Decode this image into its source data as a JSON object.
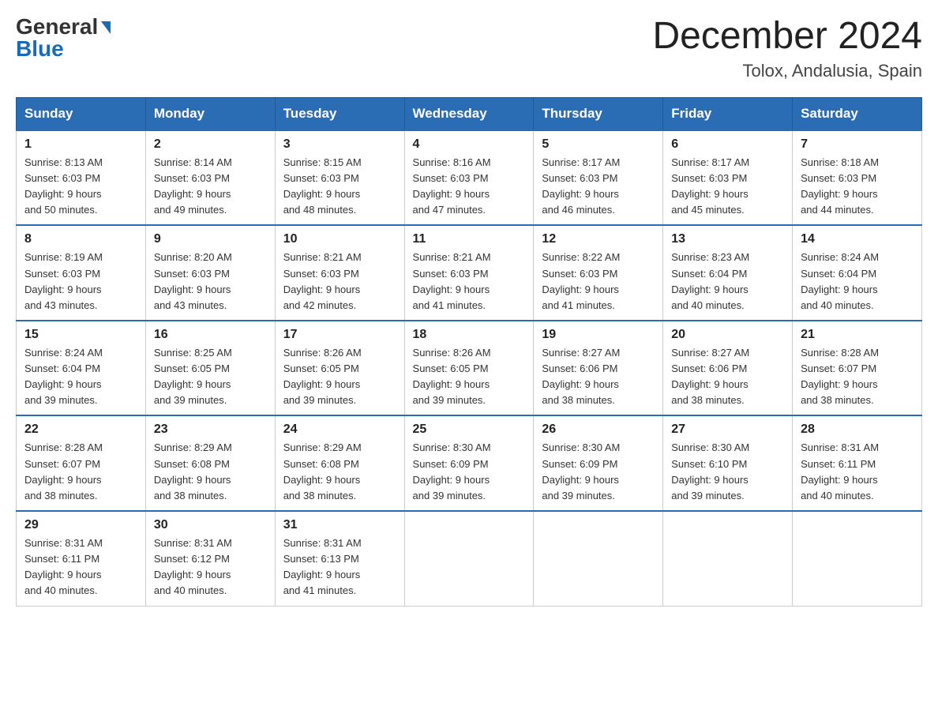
{
  "header": {
    "logo_general": "General",
    "logo_blue": "Blue",
    "month_title": "December 2024",
    "location": "Tolox, Andalusia, Spain"
  },
  "weekdays": [
    "Sunday",
    "Monday",
    "Tuesday",
    "Wednesday",
    "Thursday",
    "Friday",
    "Saturday"
  ],
  "weeks": [
    [
      {
        "day": "1",
        "sunrise": "8:13 AM",
        "sunset": "6:03 PM",
        "daylight": "9 hours and 50 minutes."
      },
      {
        "day": "2",
        "sunrise": "8:14 AM",
        "sunset": "6:03 PM",
        "daylight": "9 hours and 49 minutes."
      },
      {
        "day": "3",
        "sunrise": "8:15 AM",
        "sunset": "6:03 PM",
        "daylight": "9 hours and 48 minutes."
      },
      {
        "day": "4",
        "sunrise": "8:16 AM",
        "sunset": "6:03 PM",
        "daylight": "9 hours and 47 minutes."
      },
      {
        "day": "5",
        "sunrise": "8:17 AM",
        "sunset": "6:03 PM",
        "daylight": "9 hours and 46 minutes."
      },
      {
        "day": "6",
        "sunrise": "8:17 AM",
        "sunset": "6:03 PM",
        "daylight": "9 hours and 45 minutes."
      },
      {
        "day": "7",
        "sunrise": "8:18 AM",
        "sunset": "6:03 PM",
        "daylight": "9 hours and 44 minutes."
      }
    ],
    [
      {
        "day": "8",
        "sunrise": "8:19 AM",
        "sunset": "6:03 PM",
        "daylight": "9 hours and 43 minutes."
      },
      {
        "day": "9",
        "sunrise": "8:20 AM",
        "sunset": "6:03 PM",
        "daylight": "9 hours and 43 minutes."
      },
      {
        "day": "10",
        "sunrise": "8:21 AM",
        "sunset": "6:03 PM",
        "daylight": "9 hours and 42 minutes."
      },
      {
        "day": "11",
        "sunrise": "8:21 AM",
        "sunset": "6:03 PM",
        "daylight": "9 hours and 41 minutes."
      },
      {
        "day": "12",
        "sunrise": "8:22 AM",
        "sunset": "6:03 PM",
        "daylight": "9 hours and 41 minutes."
      },
      {
        "day": "13",
        "sunrise": "8:23 AM",
        "sunset": "6:04 PM",
        "daylight": "9 hours and 40 minutes."
      },
      {
        "day": "14",
        "sunrise": "8:24 AM",
        "sunset": "6:04 PM",
        "daylight": "9 hours and 40 minutes."
      }
    ],
    [
      {
        "day": "15",
        "sunrise": "8:24 AM",
        "sunset": "6:04 PM",
        "daylight": "9 hours and 39 minutes."
      },
      {
        "day": "16",
        "sunrise": "8:25 AM",
        "sunset": "6:05 PM",
        "daylight": "9 hours and 39 minutes."
      },
      {
        "day": "17",
        "sunrise": "8:26 AM",
        "sunset": "6:05 PM",
        "daylight": "9 hours and 39 minutes."
      },
      {
        "day": "18",
        "sunrise": "8:26 AM",
        "sunset": "6:05 PM",
        "daylight": "9 hours and 39 minutes."
      },
      {
        "day": "19",
        "sunrise": "8:27 AM",
        "sunset": "6:06 PM",
        "daylight": "9 hours and 38 minutes."
      },
      {
        "day": "20",
        "sunrise": "8:27 AM",
        "sunset": "6:06 PM",
        "daylight": "9 hours and 38 minutes."
      },
      {
        "day": "21",
        "sunrise": "8:28 AM",
        "sunset": "6:07 PM",
        "daylight": "9 hours and 38 minutes."
      }
    ],
    [
      {
        "day": "22",
        "sunrise": "8:28 AM",
        "sunset": "6:07 PM",
        "daylight": "9 hours and 38 minutes."
      },
      {
        "day": "23",
        "sunrise": "8:29 AM",
        "sunset": "6:08 PM",
        "daylight": "9 hours and 38 minutes."
      },
      {
        "day": "24",
        "sunrise": "8:29 AM",
        "sunset": "6:08 PM",
        "daylight": "9 hours and 38 minutes."
      },
      {
        "day": "25",
        "sunrise": "8:30 AM",
        "sunset": "6:09 PM",
        "daylight": "9 hours and 39 minutes."
      },
      {
        "day": "26",
        "sunrise": "8:30 AM",
        "sunset": "6:09 PM",
        "daylight": "9 hours and 39 minutes."
      },
      {
        "day": "27",
        "sunrise": "8:30 AM",
        "sunset": "6:10 PM",
        "daylight": "9 hours and 39 minutes."
      },
      {
        "day": "28",
        "sunrise": "8:31 AM",
        "sunset": "6:11 PM",
        "daylight": "9 hours and 40 minutes."
      }
    ],
    [
      {
        "day": "29",
        "sunrise": "8:31 AM",
        "sunset": "6:11 PM",
        "daylight": "9 hours and 40 minutes."
      },
      {
        "day": "30",
        "sunrise": "8:31 AM",
        "sunset": "6:12 PM",
        "daylight": "9 hours and 40 minutes."
      },
      {
        "day": "31",
        "sunrise": "8:31 AM",
        "sunset": "6:13 PM",
        "daylight": "9 hours and 41 minutes."
      },
      null,
      null,
      null,
      null
    ]
  ]
}
